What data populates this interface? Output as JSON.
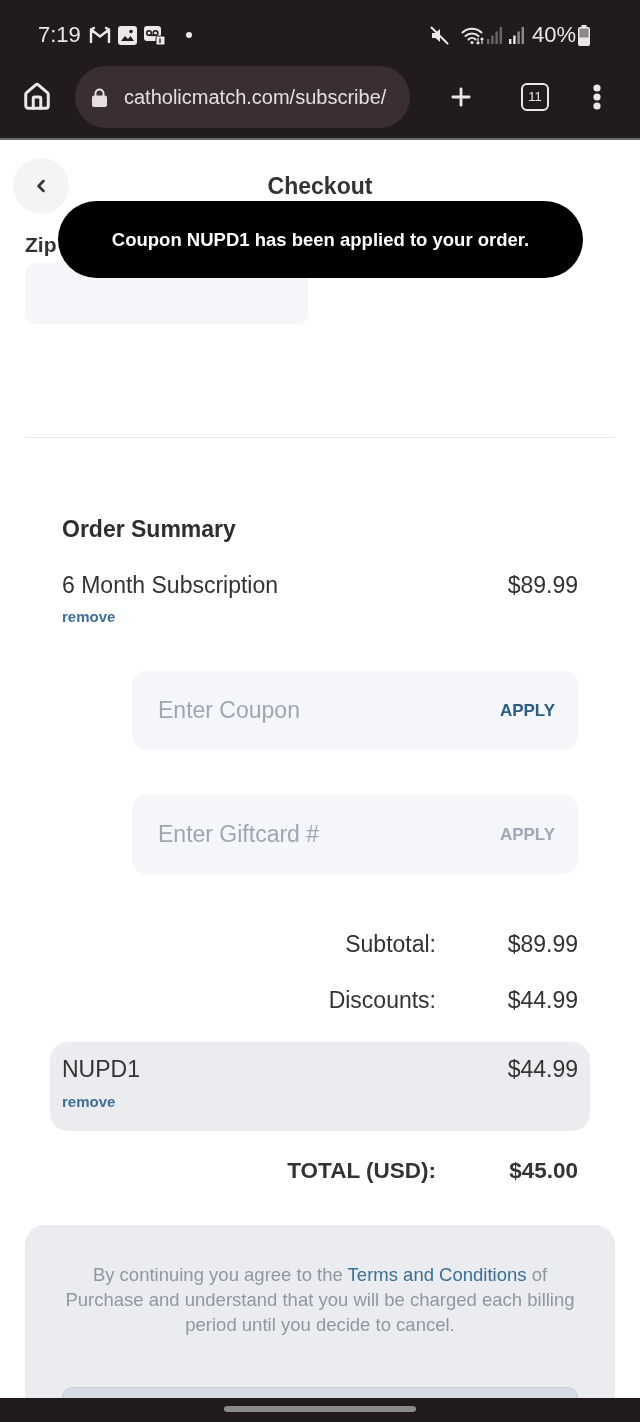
{
  "status_bar": {
    "time": "7:19",
    "battery": "40%"
  },
  "browser": {
    "url": "catholicmatch.com/subscribe/",
    "tab_count": "11"
  },
  "header": {
    "title": "Checkout"
  },
  "toast": {
    "text": "Coupon NUPD1 has been applied to your order."
  },
  "billing": {
    "zip_label": "Zip"
  },
  "order_summary": {
    "title": "Order Summary",
    "items": [
      {
        "name": "6 Month Subscription",
        "price": "$89.99",
        "action": "remove"
      }
    ],
    "code_fields": [
      {
        "placeholder": "Enter Coupon",
        "button": "APPLY",
        "button_disabled": false
      },
      {
        "placeholder": "Enter Giftcard #",
        "button": "APPLY",
        "button_disabled": true
      }
    ],
    "totals": [
      {
        "label": "Subtotal:",
        "value": "$89.99"
      },
      {
        "label": "Discounts:",
        "value": "$44.99"
      }
    ],
    "applied_coupons": [
      {
        "code": "NUPD1",
        "amount": "$44.99",
        "action": "remove"
      }
    ],
    "total": {
      "label": "TOTAL (USD):",
      "value": "$45.00"
    }
  },
  "terms": {
    "text_before": "By continuing you agree to the",
    "link": "Terms and Conditions",
    "text_after": "of Purchase and understand that you will be charged each billing period until you decide to cancel."
  }
}
